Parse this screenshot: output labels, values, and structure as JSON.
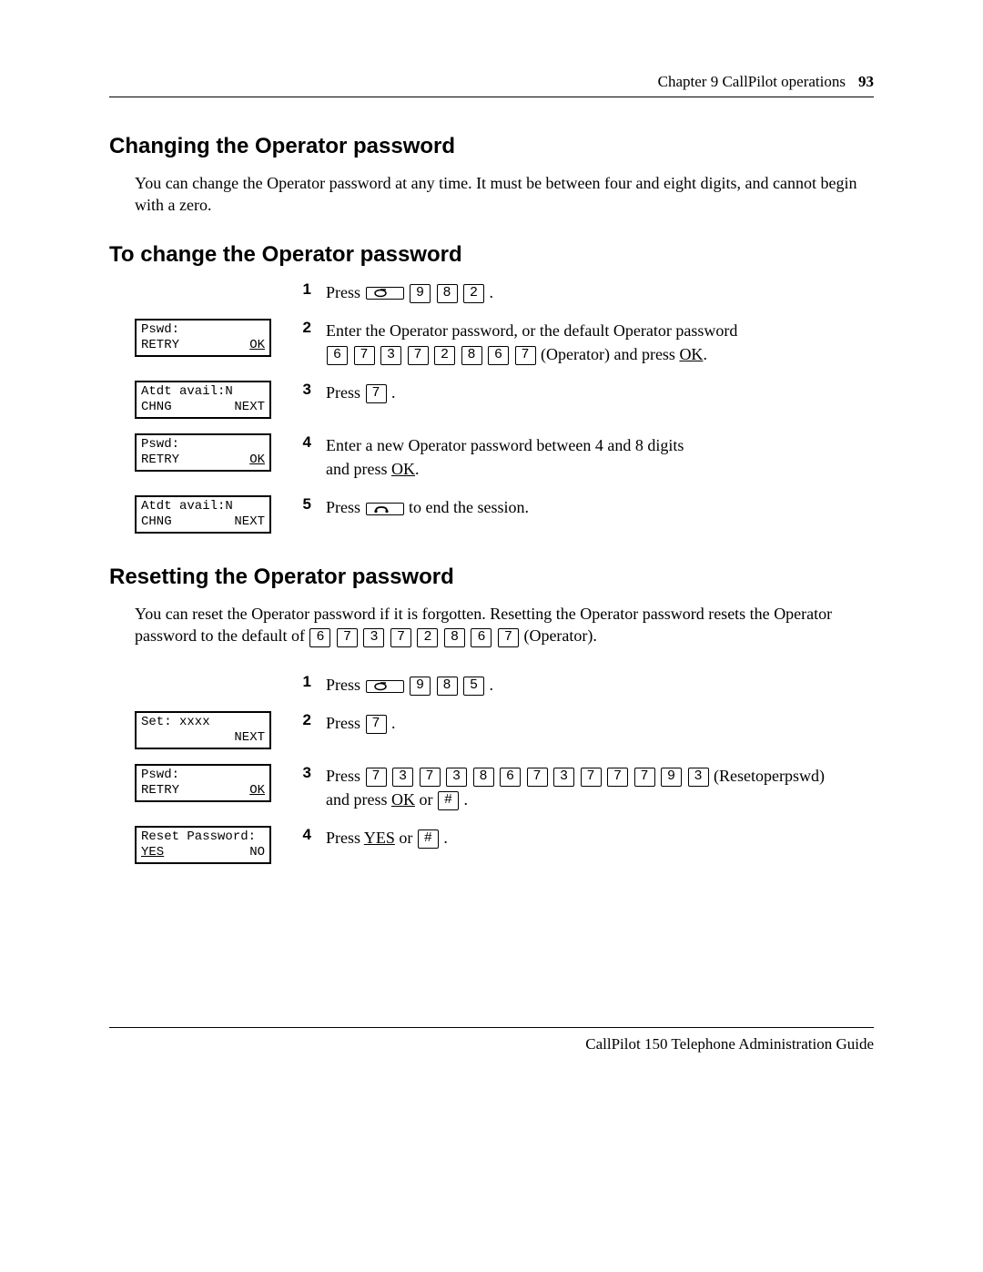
{
  "header": {
    "chapter": "Chapter 9  CallPilot operations",
    "pagenum": "93"
  },
  "footer": {
    "text": "CallPilot 150 Telephone Administration Guide"
  },
  "section1": {
    "heading": "Changing the Operator password",
    "intro": "You can change the Operator password at any time. It must be between four and eight digits, and cannot begin with a zero."
  },
  "section2": {
    "heading": "To change the Operator password",
    "steps": [
      {
        "num": "1",
        "text_a": "Press ",
        "keys": [
          "9",
          "8",
          "2"
        ],
        "text_b": " .",
        "has_feature_key": true
      },
      {
        "num": "2",
        "lcd": {
          "line1": "Pswd:",
          "left": "RETRY",
          "right": "OK",
          "right_underline": true
        },
        "text_a": "Enter the Operator password, or the default Operator password",
        "keys": [
          "6",
          "7",
          "3",
          "7",
          "2",
          "8",
          "6",
          "7"
        ],
        "text_mid": " (Operator) and press ",
        "soft": "OK",
        "text_end": "."
      },
      {
        "num": "3",
        "lcd": {
          "line1": "Atdt avail:N",
          "left": "CHNG",
          "right": "NEXT"
        },
        "text_a": "Press ",
        "keys": [
          "7"
        ],
        "text_b": " ."
      },
      {
        "num": "4",
        "lcd": {
          "line1": "Pswd:",
          "left": "RETRY",
          "right": "OK",
          "right_underline": true
        },
        "text_a": "Enter a new Operator password between 4 and 8 digits",
        "text_b": "and press ",
        "soft": "OK",
        "text_end": "."
      },
      {
        "num": "5",
        "lcd": {
          "line1": "Atdt avail:N",
          "left": "CHNG",
          "right": "NEXT"
        },
        "text_a": "Press ",
        "has_release_key": true,
        "text_b": " to end the session."
      }
    ]
  },
  "section3": {
    "heading": "Resetting the Operator password",
    "intro_a": "You can reset the Operator password if it is forgotten. Resetting the Operator password resets the ",
    "intro_b": "Operator password to the default of ",
    "intro_keys": [
      "6",
      "7",
      "3",
      "7",
      "2",
      "8",
      "6",
      "7"
    ],
    "intro_c": " (Operator).",
    "steps": [
      {
        "num": "1",
        "text_a": "Press ",
        "has_feature_key": true,
        "keys": [
          "9",
          "8",
          "5"
        ],
        "text_b": " ."
      },
      {
        "num": "2",
        "lcd": {
          "line1": "Set: xxxx",
          "left": "",
          "right": "NEXT"
        },
        "text_a": "Press ",
        "keys": [
          "7"
        ],
        "text_b": " ."
      },
      {
        "num": "3",
        "lcd": {
          "line1": "Pswd:",
          "left": "RETRY",
          "right": "OK",
          "right_underline": true
        },
        "text_a": "Press ",
        "keys": [
          "7",
          "3",
          "7",
          "3",
          "8",
          "6",
          "7",
          "3",
          "7",
          "7",
          "7",
          "9",
          "3"
        ],
        "text_mid": " (Resetoperpswd)",
        "text_b": "and press ",
        "soft": "OK",
        " or_key": "#",
        "text_end": " ."
      },
      {
        "num": "4",
        "lcd": {
          "line1": "Reset Password:",
          "left": "YES",
          "left_underline": true,
          "right": "NO"
        },
        "text_a": "Press ",
        "soft": "YES",
        "text_mid": " or ",
        "keys": [
          "#"
        ],
        "text_end": " ."
      }
    ]
  }
}
